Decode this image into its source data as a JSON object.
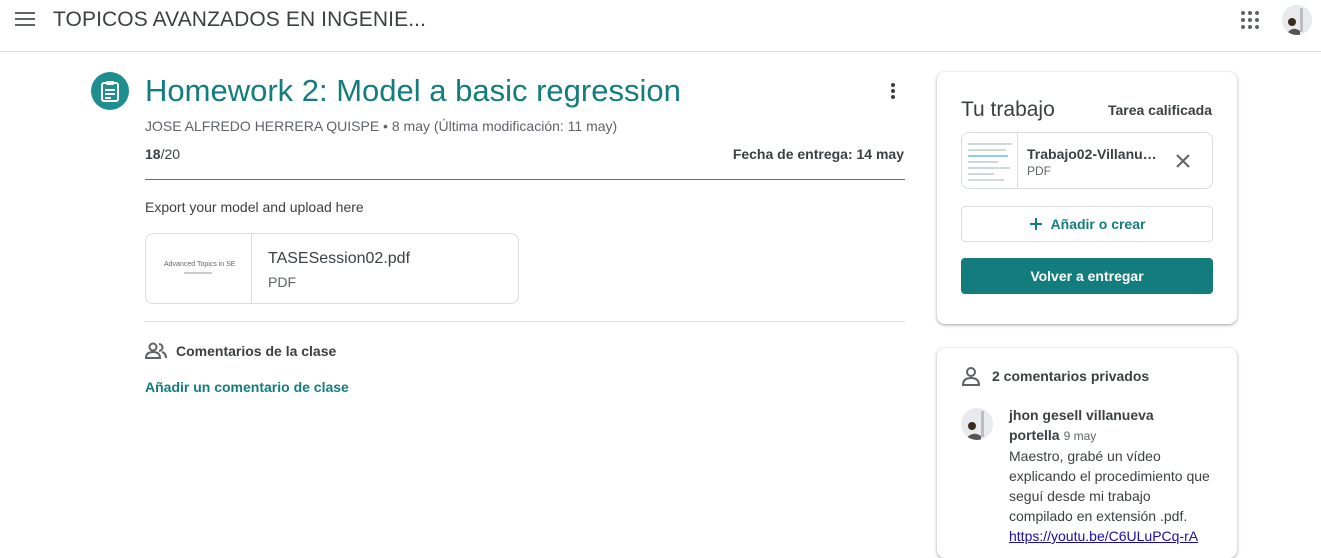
{
  "header": {
    "course_title": "TOPICOS AVANZADOS EN INGENIE...",
    "menu_icon": "hamburger-menu-icon",
    "apps_icon": "apps-grid-icon"
  },
  "assignment": {
    "title": "Homework 2: Model a basic regression",
    "meta": "JOSE ALFREDO HERRERA QUISPE • 8 may (Última modificación: 11 may)",
    "grade_value": "18",
    "grade_total": "/20",
    "due": "Fecha de entrega: 14 may",
    "instructions": "Export your model and upload here",
    "attachment": {
      "thumb_text": "Advanced Topics in SE",
      "name": "TASESession02.pdf",
      "type": "PDF"
    }
  },
  "class_comments": {
    "label": "Comentarios de la clase",
    "add_label": "Añadir un comentario de clase"
  },
  "your_work": {
    "title": "Tu trabajo",
    "status": "Tarea calificada",
    "file": {
      "name": "Trabajo02-Villanueva",
      "type": "PDF"
    },
    "add_label": "Añadir o crear",
    "resubmit_label": "Volver a entregar"
  },
  "private_comments": {
    "label": "2 comentarios privados",
    "comment": {
      "author": "jhon gesell villanueva portella",
      "date": "9 may",
      "text": "Maestro, grabé un vídeo explicando el procedimiento que seguí desde mi trabajo compilado en extensión .pdf.",
      "link": "https://youtu.be/C6ULuPCq-rA"
    }
  },
  "colors": {
    "accent": "#137d7d",
    "icon_bg": "#1e8e8e"
  }
}
